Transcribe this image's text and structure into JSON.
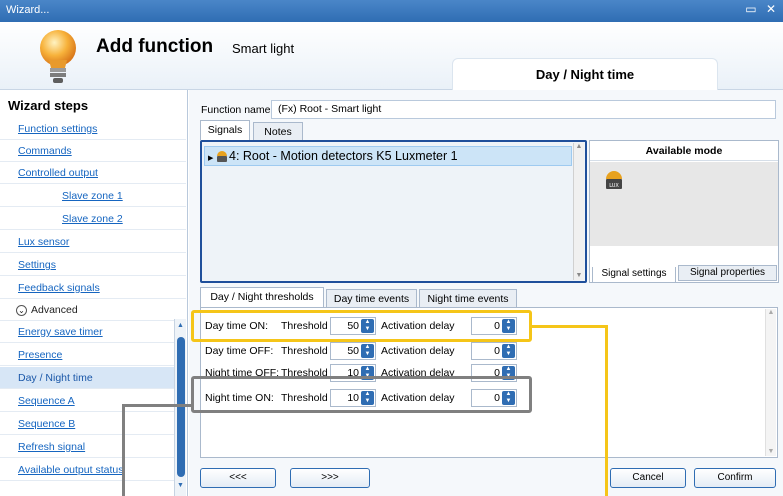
{
  "window": {
    "title": "Wizard...",
    "controls": "▭ ✕"
  },
  "header": {
    "title": "Add function",
    "subtitle": "Smart light",
    "current_step": "Day / Night time"
  },
  "sidebar": {
    "title": "Wizard steps",
    "items": [
      {
        "label": "Function settings"
      },
      {
        "label": "Commands"
      },
      {
        "label": "Controlled output"
      },
      {
        "label": "Slave zone 1"
      },
      {
        "label": "Slave zone 2"
      },
      {
        "label": "Lux sensor"
      },
      {
        "label": "Settings"
      },
      {
        "label": "Feedback signals"
      },
      {
        "label": "Advanced"
      },
      {
        "label": "Energy save timer"
      },
      {
        "label": "Presence"
      },
      {
        "label": "Day / Night time"
      },
      {
        "label": "Sequence A"
      },
      {
        "label": "Sequence B"
      },
      {
        "label": "Refresh signal"
      },
      {
        "label": "Available output status"
      }
    ]
  },
  "function": {
    "label": "Function name:",
    "value": "(Fx) Root - Smart light"
  },
  "top_tabs": [
    "Signals",
    "Notes"
  ],
  "signals": {
    "selected": "4: Root - Motion detectors K5 Luxmeter 1"
  },
  "available_mode": {
    "title": "Available mode",
    "tabs": [
      "Signal settings",
      "Signal properties"
    ]
  },
  "lower_tabs": [
    "Day / Night thresholds",
    "Day time events",
    "Night time events"
  ],
  "thresholds": {
    "threshold_label": "Threshold",
    "delay_label": "Activation delay",
    "rows": [
      {
        "name": "Day time ON:",
        "threshold": "50",
        "delay": "0"
      },
      {
        "name": "Day time OFF:",
        "threshold": "50",
        "delay": "0"
      },
      {
        "name": "Night time OFF:",
        "threshold": "10",
        "delay": "0"
      },
      {
        "name": "Night time ON:",
        "threshold": "10",
        "delay": "0"
      }
    ]
  },
  "buttons": {
    "prev": "<<<",
    "next": ">>>",
    "cancel": "Cancel",
    "confirm": "Confirm"
  },
  "colors": {
    "highlight_day": "#f5c518",
    "highlight_night": "#808080",
    "accent": "#2f6db3"
  }
}
